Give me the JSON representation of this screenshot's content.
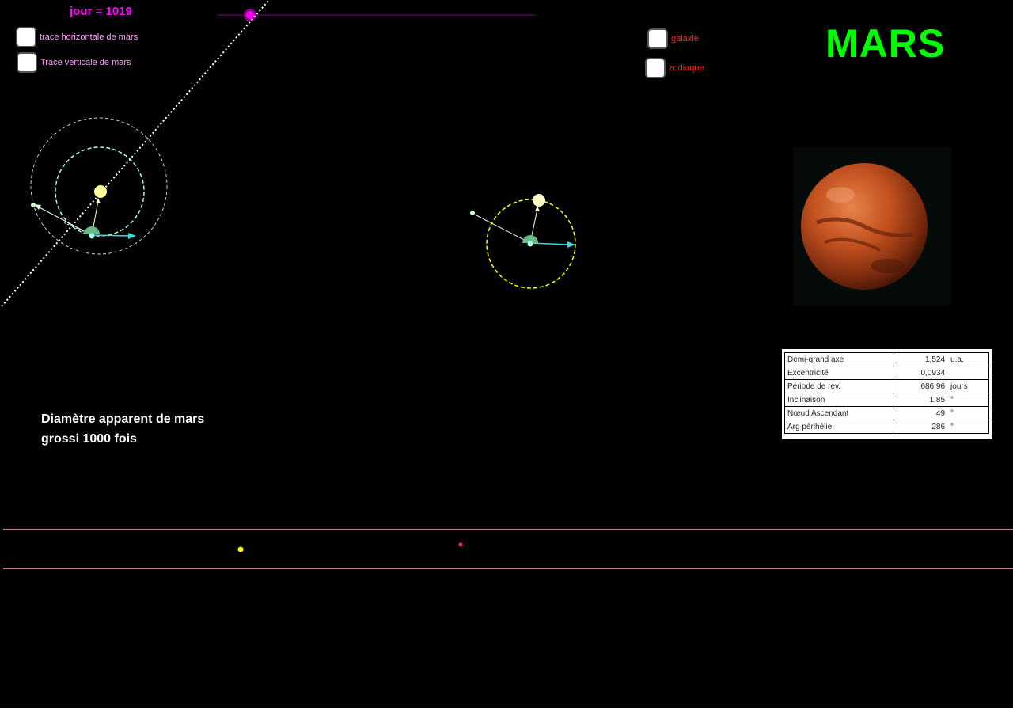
{
  "controls": {
    "day_label": "jour = 1019",
    "day_value": 1019,
    "checkboxes": [
      {
        "label": "trace horizontale de mars",
        "checked": false
      },
      {
        "label": "Trace verticale de mars",
        "checked": false
      },
      {
        "label": "galaxie",
        "checked": false
      },
      {
        "label": "zodiaque",
        "checked": false
      }
    ]
  },
  "planet": {
    "title": "MARS",
    "apparent_line1": "Diamètre apparent de mars",
    "apparent_line2": "grossi 1000 fois"
  },
  "orbital_table": [
    {
      "label": "Demi-grand axe",
      "value": "1,524",
      "unit": "u.a."
    },
    {
      "label": "Excentricité",
      "value": "0,0934",
      "unit": ""
    },
    {
      "label": "Période de rev.",
      "value": "686,96",
      "unit": "jours"
    },
    {
      "label": "Inclinaison",
      "value": "1,85",
      "unit": "°"
    },
    {
      "label": "Nœud Ascendant",
      "value": "49",
      "unit": "°"
    },
    {
      "label": "Arg périhélie",
      "value": "286",
      "unit": "°"
    }
  ],
  "colors": {
    "day_label": "#ff00ff",
    "title": "#00ff00",
    "option_labels_left": "#ff9fff",
    "option_labels_right": "#ff2020",
    "sun": "#ffff99",
    "earth_orbit": "#aaffee",
    "mars_orbit": "#ffff00",
    "horizon_lines": "#ffb0c0"
  }
}
